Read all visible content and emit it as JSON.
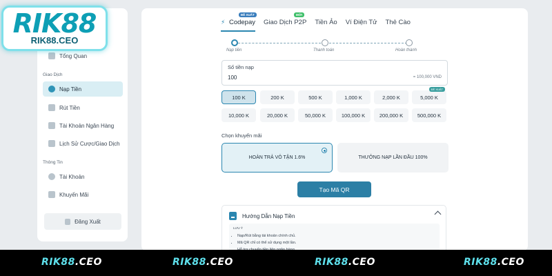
{
  "logo": {
    "main": "RIK88",
    "sub": "RIK88.CEO"
  },
  "sidebar": {
    "overview": "Tổng Quan",
    "group_transactions": "Giao Dịch",
    "deposit": "Nạp Tiền",
    "withdraw": "Rút Tiền",
    "bank_account": "Tài Khoản Ngân Hàng",
    "history": "Lịch Sử Cược/Giao Dịch",
    "group_info": "Thông Tin",
    "account": "Tài Khoản",
    "promotions": "Khuyến Mãi",
    "logout": "Đăng Xuất"
  },
  "tabs": [
    {
      "label": "Codepay",
      "badge": "ĐỀ XUẤT"
    },
    {
      "label": "Giao Dịch P2P",
      "badge": "MỚI"
    },
    {
      "label": "Tiền Ảo"
    },
    {
      "label": "Ví Điện Tử"
    },
    {
      "label": "Thẻ Cào"
    }
  ],
  "steps": [
    "Nạp tiền",
    "Thanh toán",
    "Hoàn thành"
  ],
  "amount": {
    "label": "Số tiền nạp",
    "value": "100",
    "converted": "= 100,000 VND"
  },
  "chips": [
    "100 K",
    "200 K",
    "500 K",
    "1,000 K",
    "2,000 K",
    "5,000 K",
    "10,000 K",
    "20,000 K",
    "50,000 K",
    "100,000 K",
    "200,000 K",
    "500,000 K"
  ],
  "chip_badge": "ĐỀ XUẤT",
  "promo": {
    "label": "Chọn khuyến mãi",
    "option1": "HOÀN TRẢ VÔ TẬN 1.6%",
    "option2": "THƯỞNG NẠP LẦN ĐẦU 100%"
  },
  "qr_button": "Tạo Mã QR",
  "guide": {
    "title": "Hướng Dẫn Nạp Tiền",
    "note_title": "LƯU Ý",
    "notes": [
      "Nạp/Rút bằng tài khoản chính chủ.",
      "Mã QR chỉ có thể sử dụng một lần.",
      "Hỗ trợ chuyển tiền liên ngân hàng."
    ]
  },
  "watermark": {
    "brand": "RIK88",
    "suffix": ".CEO"
  },
  "colors": {
    "accent": "#2a86b0",
    "logo": "#0d9fb5",
    "watermark": "#5ee0ec"
  }
}
